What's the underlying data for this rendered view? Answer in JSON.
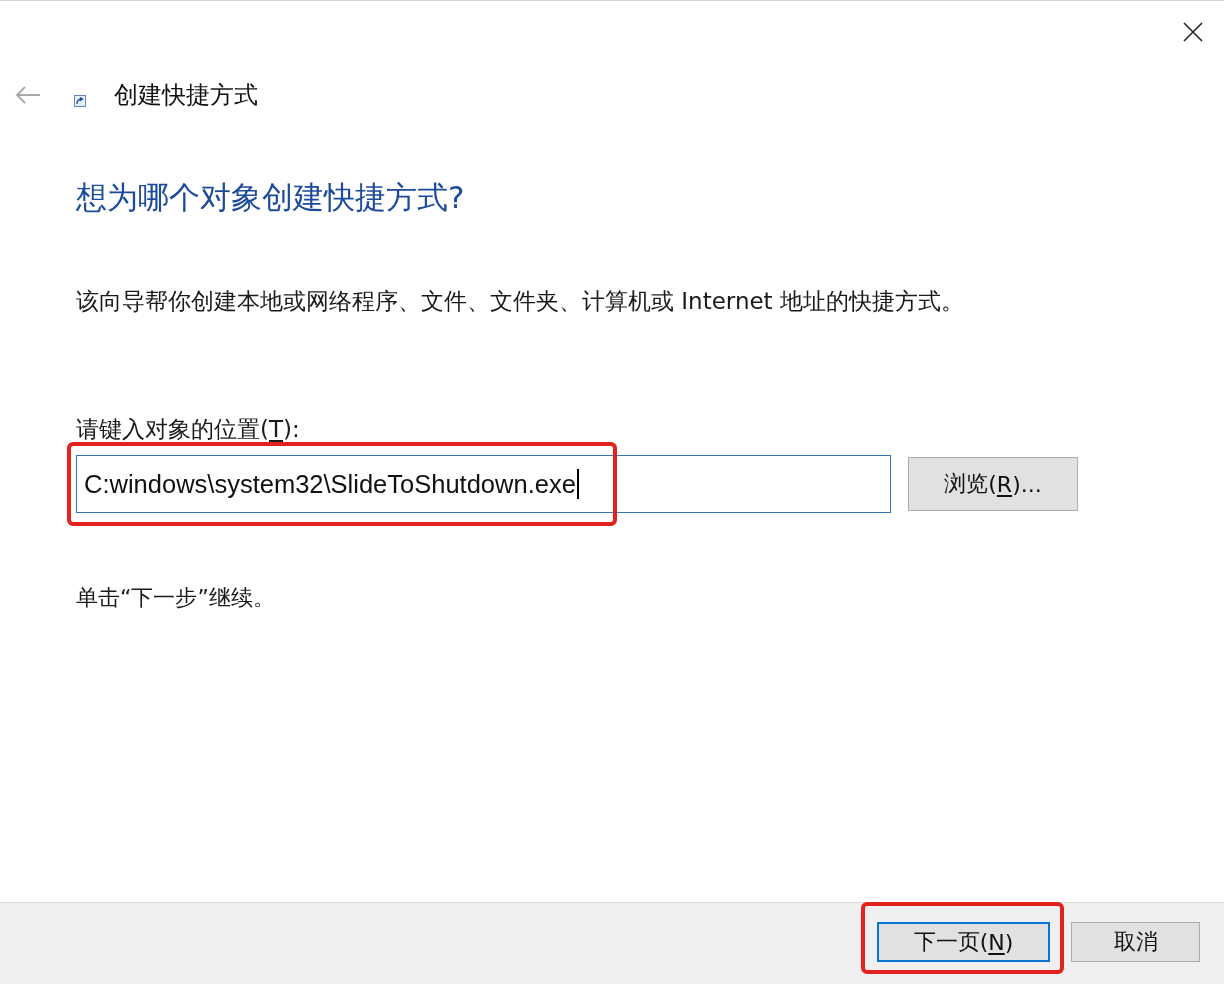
{
  "window": {
    "title": "创建快捷方式",
    "back_button": {
      "disabled": true
    }
  },
  "heading": "想为哪个对象创建快捷方式?",
  "description": "该向导帮你创建本地或网络程序、文件、文件夹、计算机或 Internet 地址的快捷方式。",
  "location": {
    "label": {
      "label": "请键入对象的位置(",
      "access_key": "T",
      "label_end": "):"
    },
    "value": "C:windows\\system32\\SlideToShutdown.exe",
    "focused": true,
    "highlighted": true
  },
  "browse_button": {
    "label": "浏览(",
    "access_key": "R",
    "label_end": ")..."
  },
  "hint": "单击“下一步”继续。",
  "footer_buttons": [
    {
      "label": "下一页(",
      "access_key": "N",
      "label_end": ")",
      "default": true,
      "highlighted": true
    },
    {
      "label": "取消",
      "default": false,
      "highlighted": false
    }
  ]
}
